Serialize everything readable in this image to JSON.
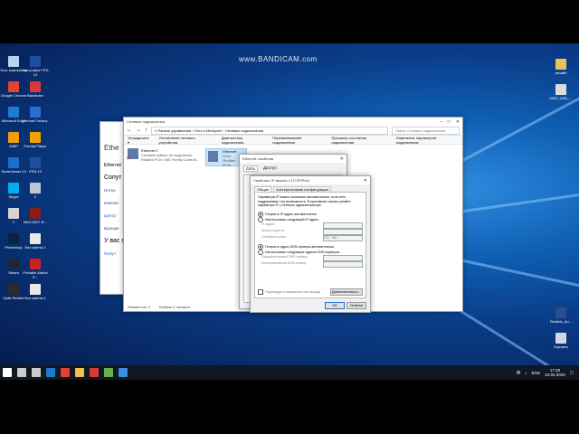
{
  "watermark": "www.BANDICAM.com",
  "desktop_icons_left": [
    {
      "label": "Этот компьютер",
      "color": "#b9d4ef"
    },
    {
      "label": "Google Chrome",
      "color": "#e2442f"
    },
    {
      "label": "Microsoft Edge",
      "color": "#1f7ad6"
    },
    {
      "label": "AIMP",
      "color": "#f39c12"
    },
    {
      "label": "TeamViewer 13",
      "color": "#1b6fd1"
    },
    {
      "label": "Skype",
      "color": "#00aff0"
    },
    {
      "label": "2",
      "color": "#d6d6d6"
    },
    {
      "label": "Photoshop",
      "color": "#0a2340"
    },
    {
      "label": "Steam",
      "color": "#1b2838"
    },
    {
      "label": "Optik Reader",
      "color": "#2b2b2b"
    }
  ],
  "desktop_icons_col2": [
    {
      "label": "Настройки FIFA 19",
      "color": "#1f4ea1"
    },
    {
      "label": "Bandicam",
      "color": "#d63a3a"
    },
    {
      "label": "Format Factory",
      "color": "#2b6bd6"
    },
    {
      "label": "Format Player",
      "color": "#f0a400"
    },
    {
      "label": "FIFA 19",
      "color": "#1f4ea1"
    },
    {
      "label": "2",
      "color": "#bfc7d1"
    },
    {
      "label": "BAS-2017-R...",
      "color": "#8a1b1b"
    },
    {
      "label": "Без имени-1",
      "color": "#e9e9e9"
    },
    {
      "label": "Portable Adobe P...",
      "color": "#cc2222"
    },
    {
      "label": "Без имени-1",
      "color": "#e9e9e9"
    }
  ],
  "desktop_icons_right": [
    {
      "label": "резайн",
      "color": "#e8c35a"
    },
    {
      "label": "0920_USB_...",
      "color": "#dcdcdc"
    },
    {
      "label": "Realtek_Au...",
      "color": "#2a4e8a"
    },
    {
      "label": "Корзина",
      "color": "#cfd8e3"
    }
  ],
  "bg_window": {
    "title": "Ethe",
    "labels": [
      "Ethernet",
      "Сопут",
      "Интер",
      "Измене",
      "Центр",
      "Брандм",
      "У вас п",
      "Получ"
    ]
  },
  "net_window": {
    "title": "Сетевые подключения",
    "breadcrumb": "« Панель управления › Сеть и Интернет › Сетевые подключения",
    "search_placeholder": "Поиск: Сетевые подключения",
    "toolbar": [
      "Упорядочить ▾",
      "Отключение сетевого устройства",
      "Диагностика подключения",
      "Переименование подключения",
      "Просмотр состояния подключения",
      "Изменение параметров подключения"
    ],
    "adapters": [
      {
        "name": "Ethernet 2",
        "status": "Сетевой кабель не подключен",
        "device": "Realtek PCIe GbE Family Controll..."
      },
      {
        "name": "Ethernet",
        "status": "Сеть",
        "device": "Realtek PCIe..."
      }
    ],
    "statusbar": [
      "Элементов: 2",
      "Выбран 1 элемент"
    ]
  },
  "props_window": {
    "title": "Ethernet: свойства",
    "tabs": [
      "Сеть",
      "Доступ"
    ]
  },
  "ipv4_dialog": {
    "title": "Свойства: IP версии 4 (TCP/IPv4)",
    "tabs": [
      "Общие",
      "Альтернативная конфигурация"
    ],
    "description": "Параметры IP можно назначать автоматически, если сеть поддерживает эту возможность. В противном случае узнайте параметры IP у сетевого администратора.",
    "auto_ip": "Получить IP-адрес автоматически",
    "manual_ip": "Использовать следующий IP-адрес:",
    "ip_fields": [
      "IP-адрес:",
      "Маска подсети:",
      "Основной шлюз:"
    ],
    "gateway_value": "120 . 168 .    .   ",
    "auto_dns": "Получить адрес DNS-сервера автоматически",
    "manual_dns": "Использовать следующие адреса DNS-серверов:",
    "dns_fields": [
      "Предпочитаемый DNS-сервер:",
      "Альтернативный DNS-сервер:"
    ],
    "validate": "Подтвердить параметры при выходе",
    "advanced": "Дополнительно...",
    "ok": "ОК",
    "cancel": "Отмена"
  },
  "taskbar": {
    "time": "17:20",
    "date": "23.04.2020",
    "lang": "ENG",
    "apps": [
      {
        "name": "start",
        "color": "#ffffff"
      },
      {
        "name": "search",
        "color": "#cccccc"
      },
      {
        "name": "task-view",
        "color": "#cccccc"
      },
      {
        "name": "edge",
        "color": "#1f7ad6"
      },
      {
        "name": "chrome",
        "color": "#e2442f"
      },
      {
        "name": "explorer",
        "color": "#f2c04a"
      },
      {
        "name": "bandicam",
        "color": "#d63a3a"
      },
      {
        "name": "media",
        "color": "#6ab04c"
      },
      {
        "name": "network",
        "color": "#3a8ee6"
      }
    ]
  }
}
